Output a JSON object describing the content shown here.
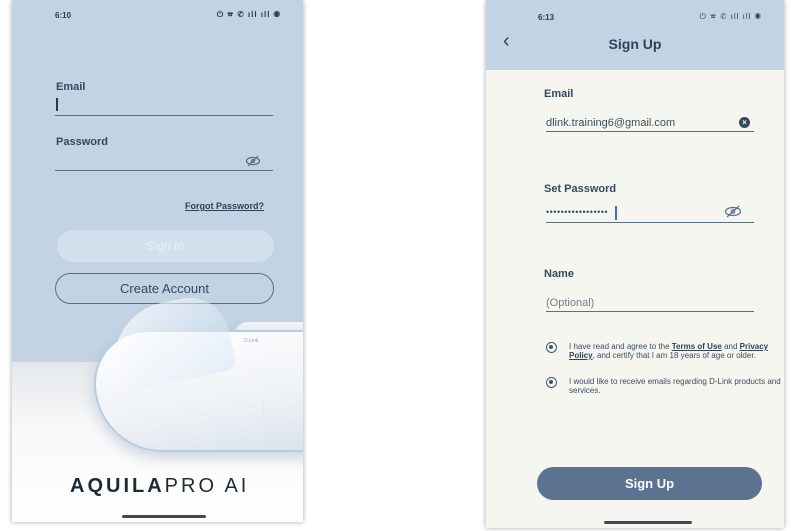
{
  "login_screen": {
    "status_time": "6:10",
    "status_icons": "⏻ ☎ ✆ ıll ıll ◉",
    "email_label": "Email",
    "password_label": "Password",
    "forgot_password": "Forgot Password?",
    "sign_in_label": "Sign In",
    "create_account_label": "Create Account",
    "brand_bold": "AQUILA",
    "brand_light": "PRO AI",
    "router_brand": "D-Link"
  },
  "signup_screen": {
    "status_time": "6:13",
    "status_icons": "⏻ ☎ ✆ ıll ıll ◉",
    "title": "Sign Up",
    "email_label": "Email",
    "email_value": "dlink.training6@gmail.com",
    "password_label": "Set Password",
    "password_mask": "•••••••••••••••••",
    "name_label": "Name",
    "name_placeholder": "(Optional)",
    "consent_terms": {
      "prefix": "I have read and agree to the ",
      "terms_link": "Terms of Use",
      "middle": " and ",
      "privacy_link": "Privacy Policy",
      "suffix": ", and certify that I am 18 years of age or older."
    },
    "consent_emails": "I would like to receive emails regarding D-Link products and services.",
    "sign_up_button": "Sign Up"
  },
  "colors": {
    "header_blue": "#c2d3e4",
    "button_dark": "#5d7190",
    "text_dark": "#34495e"
  }
}
